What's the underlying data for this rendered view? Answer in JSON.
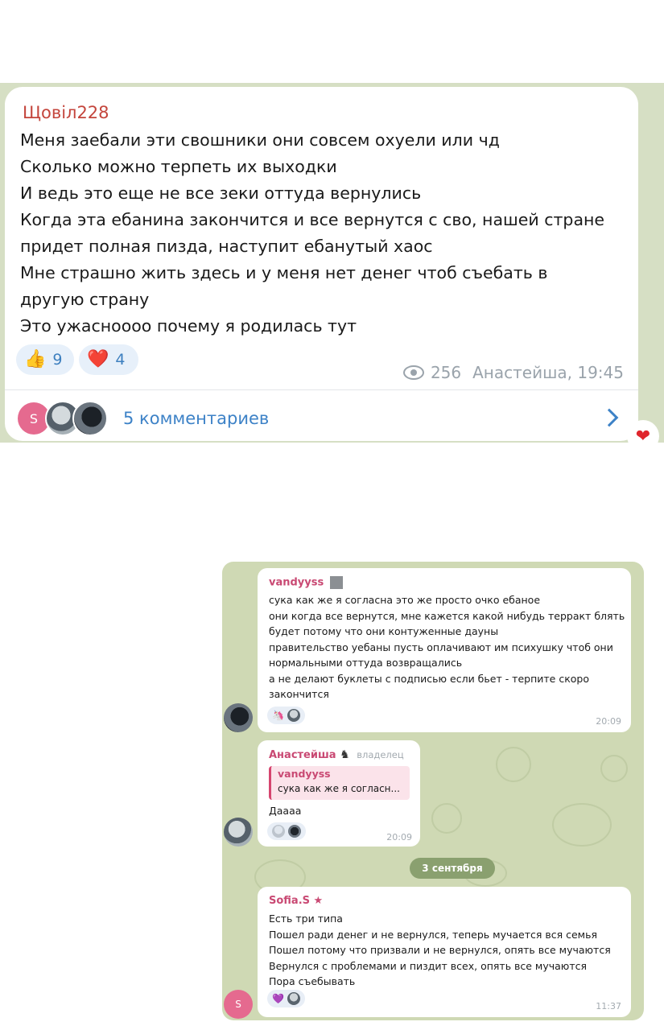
{
  "post": {
    "author": "Щовіл228",
    "lines": [
      "Меня заебали эти свошники они совсем охуели или чд",
      "Сколько можно терпеть их выходки",
      "И ведь это еще не все зеки оттуда вернулись",
      "Когда эта ебанина закончится и все вернутся с сво, нашей стране",
      "придет полная пизда, наступит ебанутый хаос",
      "Мне страшно жить здесь и у меня нет денег чтоб съебать в",
      "другую страну",
      "Это ужаснoooo почему я родилась тут"
    ],
    "reactions": [
      {
        "icon": "👍",
        "icon_name": "thumbs-up-icon",
        "count": "9"
      },
      {
        "icon": "❤️",
        "icon_name": "heart-icon",
        "count": "4"
      }
    ],
    "views": "256",
    "signature_time": "Анастейша, 19:45",
    "commenter_initial": "S",
    "comments_label": "5 комментариев",
    "heart_badge": "❤"
  },
  "chat": {
    "messages": [
      {
        "author": "vandyyss",
        "lines": [
          "сука как же я согласна это же просто очко ебаное",
          "они когда все вернутся, мне кажется какой нибудь терракт блять",
          "будет потому что они контуженные дауны",
          "правительство уебаны пусть оплачивают им психушку чтоб они",
          "нормальными оттуда возвращались",
          "а не делают буклеты с подписью если бьет - терпите скоро",
          "закончится"
        ],
        "reaction_icon": "🦄",
        "time": "20:09"
      },
      {
        "author": "Анастейша",
        "badge": "владелец",
        "reply_author": "vandyyss",
        "reply_text": "сука как же я согласн...",
        "text": "Даааа",
        "time": "20:09"
      },
      {
        "author": "Sofia.S ★",
        "lines": [
          "Есть три типа",
          "Пошел ради денег и не вернулся, теперь мучается вся семья",
          "Пошел потому что призвали и не вернулся, опять все мучаются",
          "Вернулся с проблемами и пиздит всех, опять все мучаются",
          "Пора съебывать"
        ],
        "reaction_icon": "💜",
        "avatar_initial": "S",
        "time": "11:37"
      }
    ],
    "date_separator": "3 сентября"
  },
  "colors": {
    "author_red": "#c4453c",
    "link_blue": "#3d82c7",
    "chat_name_pink": "#c94973",
    "chat_bg": "#cfd9b4",
    "post_bg": "#d6dfc4"
  }
}
